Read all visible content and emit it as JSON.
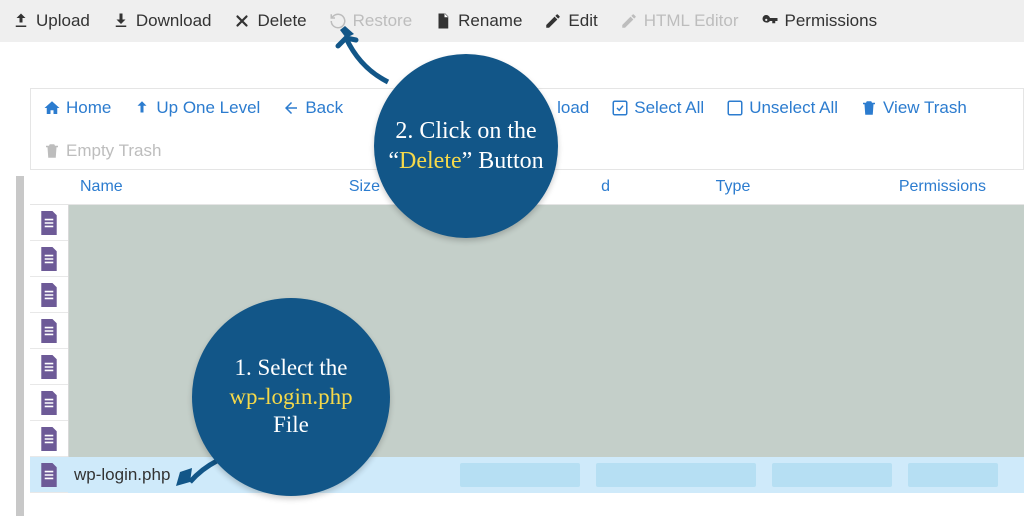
{
  "toolbar_top": {
    "upload": "Upload",
    "download": "Download",
    "delete": "Delete",
    "restore": "Restore",
    "rename": "Rename",
    "edit": "Edit",
    "html_editor": "HTML Editor",
    "permissions": "Permissions"
  },
  "toolbar_nav": {
    "home": "Home",
    "up_one_level": "Up One Level",
    "back": "Back",
    "forward_hidden": "",
    "reload_partial": "load",
    "select_all": "Select All",
    "unselect_all": "Unselect All",
    "view_trash": "View Trash",
    "empty_trash": "Empty Trash"
  },
  "columns": {
    "name": "Name",
    "size": "Size",
    "modified_partial": "d",
    "type": "Type",
    "permissions": "Permissions"
  },
  "files": [
    {
      "name": "",
      "selected": false
    },
    {
      "name": "",
      "selected": false
    },
    {
      "name": "",
      "selected": false
    },
    {
      "name": "",
      "selected": false
    },
    {
      "name": "",
      "selected": false
    },
    {
      "name": "",
      "selected": false
    },
    {
      "name": "",
      "selected": false
    },
    {
      "name": "wp-login.php",
      "selected": true
    }
  ],
  "callouts": {
    "c1_prefix": "1. Select the",
    "c1_hl": "wp-login.php",
    "c1_suffix": "File",
    "c2_prefix": "2. Click on the “",
    "c2_hl": "Delete",
    "c2_suffix": "” Button"
  },
  "colors": {
    "link_blue": "#2c7ccf",
    "callout_bg": "#125688",
    "highlight": "#f5d94a",
    "file_icon": "#6d5a97",
    "selected_bg": "#cfeafa"
  }
}
